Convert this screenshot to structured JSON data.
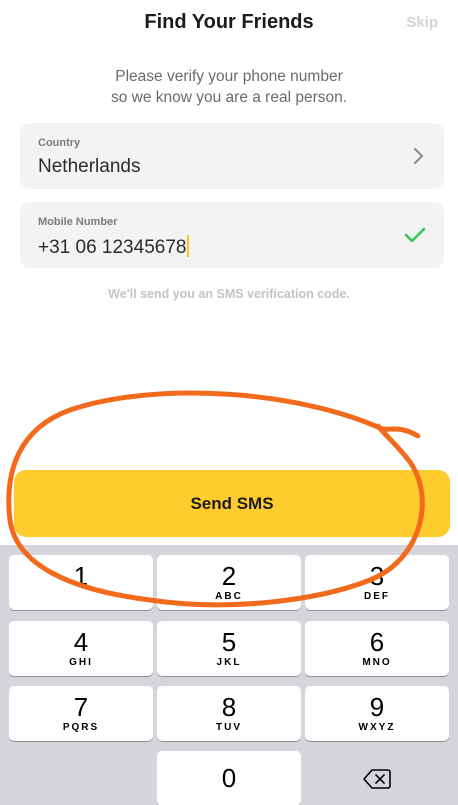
{
  "header": {
    "title": "Find Your Friends",
    "skip_label": "Skip"
  },
  "subtitle": {
    "line1": "Please verify your phone number",
    "line2": "so we know you are a real person."
  },
  "country": {
    "label": "Country",
    "value": "Netherlands",
    "icon": "chevron-right-icon"
  },
  "mobile": {
    "label": "Mobile Number",
    "value": "+31 06 12345678",
    "icon": "checkmark-icon"
  },
  "hint": "We'll send you an SMS verification code.",
  "send_button": {
    "label": "Send SMS"
  },
  "keypad": {
    "keys": [
      {
        "digit": "1",
        "letters": ""
      },
      {
        "digit": "2",
        "letters": "ABC"
      },
      {
        "digit": "3",
        "letters": "DEF"
      },
      {
        "digit": "4",
        "letters": "GHI"
      },
      {
        "digit": "5",
        "letters": "JKL"
      },
      {
        "digit": "6",
        "letters": "MNO"
      },
      {
        "digit": "7",
        "letters": "PQRS"
      },
      {
        "digit": "8",
        "letters": "TUV"
      },
      {
        "digit": "9",
        "letters": "WXYZ"
      },
      {
        "digit": "0",
        "letters": ""
      }
    ],
    "delete_icon": "backspace-icon"
  },
  "colors": {
    "accent": "#ffcc2e",
    "check": "#34c759",
    "annotation": "#f26b1d"
  }
}
